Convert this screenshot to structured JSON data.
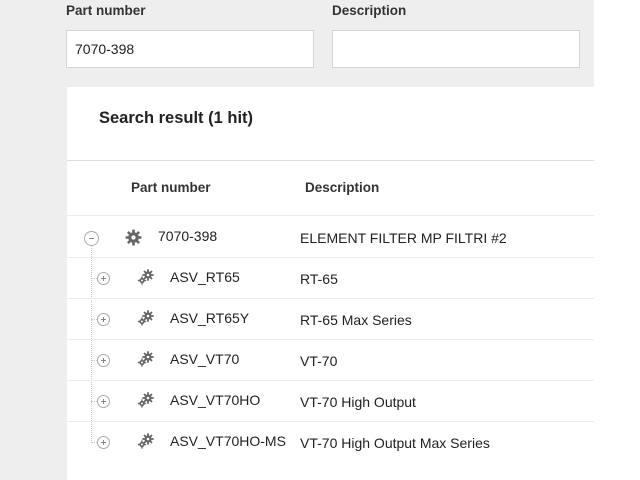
{
  "filters": {
    "part_number": {
      "label": "Part number",
      "value": "7070-398"
    },
    "description": {
      "label": "Description",
      "value": ""
    }
  },
  "results": {
    "title": "Search result (1 hit)",
    "columns": {
      "part_number": "Part number",
      "description": "Description"
    },
    "parent": {
      "part_number": "7070-398",
      "description": "ELEMENT FILTER MP FILTRI #2",
      "toggle": "collapse-icon",
      "icon": "gear-icon"
    },
    "children": [
      {
        "part_number": "ASV_RT65",
        "description": "RT-65",
        "toggle": "expand-icon",
        "icon": "gears-icon"
      },
      {
        "part_number": "ASV_RT65Y",
        "description": "RT-65 Max Series",
        "toggle": "expand-icon",
        "icon": "gears-icon"
      },
      {
        "part_number": "ASV_VT70",
        "description": "VT-70",
        "toggle": "expand-icon",
        "icon": "gears-icon"
      },
      {
        "part_number": "ASV_VT70HO",
        "description": "VT-70 High Output",
        "toggle": "expand-icon",
        "icon": "gears-icon"
      },
      {
        "part_number": "ASV_VT70HO-MS",
        "description": "VT-70 High Output Max Series",
        "toggle": "expand-icon",
        "icon": "gears-icon"
      }
    ]
  },
  "colors": {
    "panel_bg": "#eeeeee",
    "icon_gray": "#666666",
    "border": "#d4d4d4"
  }
}
